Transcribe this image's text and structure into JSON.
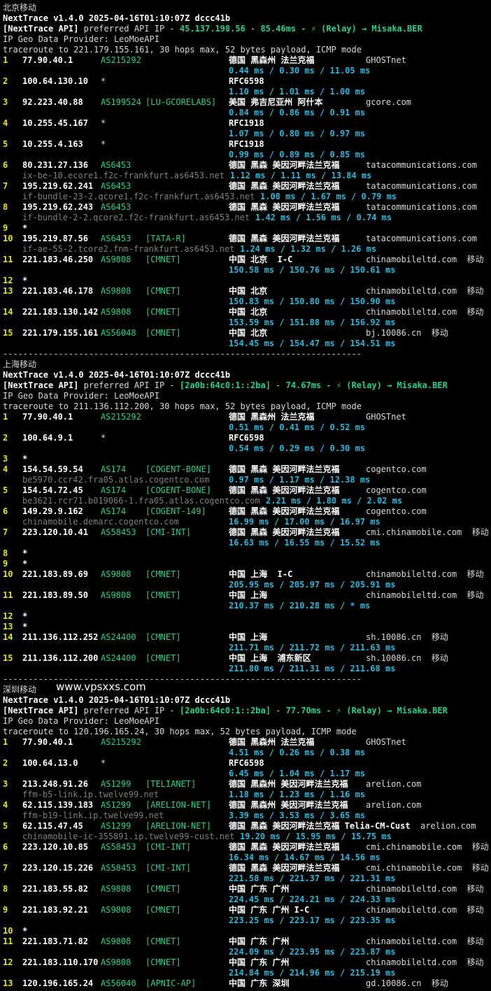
{
  "sections": [
    {
      "label": "北京移动",
      "version": "NextTrace v1.4.0 2025-04-16T01:10:07Z dccc41b",
      "api_tag": "[NextTrace API]",
      "api_mid": " preferred API IP - ",
      "api_ip": "45.137.198.56",
      "api_sep": " - ",
      "api_ms": "85.46ms",
      "api_tail": " - ⚡ (Relay) → Misaka.BER",
      "geo": "IP Geo Data Provider: LeoMoeAPI",
      "trace": "traceroute to 221.179.155.161, 30 hops max, 52 bytes payload, ICMP mode",
      "hops": [
        {
          "n": "1",
          "ip": "77.90.40.1",
          "asn": "AS215292",
          "tag": "",
          "geo": "德国 黑森州 法兰克福",
          "org": "GHOSTnet",
          "ptr": "",
          "rtt": "0.44 ms / 0.30 ms / 11.05 ms"
        },
        {
          "n": "2",
          "ip": "100.64.130.10",
          "asn": "*",
          "tag": "",
          "geo": "RFC6598",
          "org": "",
          "ptr": "",
          "rtt": "1.10 ms / 1.01 ms / 1.00 ms"
        },
        {
          "n": "3",
          "ip": "92.223.40.88",
          "asn": "AS199524",
          "tag": "[LU-GCORELABS]",
          "geo": "美国 弗吉尼亚州 阿什本",
          "org": "gcore.com",
          "ptr": "",
          "rtt": "0.84 ms / 0.86 ms / 0.91 ms"
        },
        {
          "n": "4",
          "ip": "10.255.45.167",
          "asn": "*",
          "tag": "",
          "geo": "RFC1918",
          "org": "",
          "ptr": "",
          "rtt": "1.07 ms / 0.80 ms / 0.97 ms"
        },
        {
          "n": "5",
          "ip": "10.255.4.163",
          "asn": "*",
          "tag": "",
          "geo": "RFC1918",
          "org": "",
          "ptr": "",
          "rtt": "0.99 ms / 0.89 ms / 0.85 ms"
        },
        {
          "n": "6",
          "ip": "80.231.27.136",
          "asn": "AS6453",
          "tag": "",
          "geo": "德国 黑森 美因河畔法兰克福",
          "org": "tatacommunications.com",
          "ptr": "ix-be-10.ecore1.f2c-frankfurt.as6453.net",
          "rtt": "1.12 ms / 1.11 ms / 13.84 ms"
        },
        {
          "n": "7",
          "ip": "195.219.62.241",
          "asn": "AS6453",
          "tag": "",
          "geo": "德国 黑森 美因河畔法兰克福",
          "org": "tatacommunications.com",
          "ptr": "if-bundle-23-2.qcore1.f2c-frankfurt.as6453.net",
          "rtt": "1.08 ms / 1.67 ms / 0.79 ms"
        },
        {
          "n": "8",
          "ip": "195.219.62.243",
          "asn": "AS6453",
          "tag": "",
          "geo": "德国 黑森 美因河畔法兰克福",
          "org": "tatacommunications.com",
          "ptr": "if-bundle-2-2.qcore2.f2c-frankfurt.as6453.net",
          "rtt": "1.42 ms / 1.56 ms / 0.74 ms"
        },
        {
          "n": "9",
          "star": true
        },
        {
          "n": "10",
          "ip": "195.219.87.56",
          "asn": "AS6453",
          "tag": "[TATA-R]",
          "geo": "德国 黑森 美因河畔法兰克福",
          "org": "tatacommunications.com",
          "ptr": "if-ae-55-2.tcore2.fnm-frankfurt.as6453.net",
          "rtt": "1.24 ms / 1.32 ms / 1.26 ms"
        },
        {
          "n": "11",
          "ip": "221.183.46.250",
          "asn": "AS9808",
          "tag": "[CMNET]",
          "geo": "中国 北京  I-C",
          "org": "chinamobileltd.com  移动",
          "ptr": "",
          "rtt": "150.58 ms / 150.76 ms / 150.61 ms"
        },
        {
          "n": "12",
          "star": true
        },
        {
          "n": "13",
          "ip": "221.183.46.178",
          "asn": "AS9808",
          "tag": "[CMNET]",
          "geo": "中国 北京",
          "org": "chinamobileltd.com  移动",
          "ptr": "",
          "rtt": "150.83 ms / 150.80 ms / 150.90 ms"
        },
        {
          "n": "14",
          "ip": "221.183.130.142",
          "asn": "AS9808",
          "tag": "[CMNET]",
          "geo": "中国 北京",
          "org": "chinamobileltd.com  移动",
          "ptr": "",
          "rtt": "153.59 ms / 151.88 ms / 156.92 ms"
        },
        {
          "n": "15",
          "ip": "221.179.155.161",
          "asn": "AS56048",
          "tag": "[CMNET]",
          "geo": "中国 北京",
          "org": "bj.10086.cn  移动",
          "ptr": "",
          "rtt": "154.45 ms / 154.47 ms / 154.51 ms"
        }
      ]
    },
    {
      "label": "上海移动",
      "version": "NextTrace v1.4.0 2025-04-16T01:10:07Z dccc41b",
      "api_tag": "[NextTrace API]",
      "api_mid": " preferred API IP - ",
      "api_ip": "[2a0b:64c0:1::2ba]",
      "api_sep": " - ",
      "api_ms": "74.67ms",
      "api_tail": " - ⚡ (Relay) → Misaka.BER",
      "geo": "IP Geo Data Provider: LeoMoeAPI",
      "trace": "traceroute to 211.136.112.200, 30 hops max, 52 bytes payload, ICMP mode",
      "hops": [
        {
          "n": "1",
          "ip": "77.90.40.1",
          "asn": "AS215292",
          "tag": "",
          "geo": "德国 黑森州 法兰克福",
          "org": "GHOSTnet",
          "ptr": "",
          "rtt": "0.51 ms / 0.41 ms / 0.52 ms"
        },
        {
          "n": "2",
          "ip": "100.64.9.1",
          "asn": "*",
          "tag": "",
          "geo": "RFC6598",
          "org": "",
          "ptr": "",
          "rtt": "0.54 ms / 0.29 ms / 0.30 ms"
        },
        {
          "n": "3",
          "star": true
        },
        {
          "n": "4",
          "ip": "154.54.59.54",
          "asn": "AS174",
          "tag": "[COGENT-BONE]",
          "geo": "德国 黑森 美因河畔法兰克福",
          "org": "cogentco.com",
          "ptr": "be5970.ccr42.fra05.atlas.cogentco.com",
          "rtt": "0.97 ms / 1.17 ms / 12.38 ms"
        },
        {
          "n": "5",
          "ip": "154.54.72.45",
          "asn": "AS174",
          "tag": "[COGENT-BONE]",
          "geo": "德国 黑森 美因河畔法兰克福",
          "org": "cogentco.com",
          "ptr": "be3621.rcr71.b019066-1.fra05.atlas.cogentco.com",
          "rtt": "2.21 ms / 1.80 ms / 2.02 ms"
        },
        {
          "n": "6",
          "ip": "149.29.9.162",
          "asn": "AS174",
          "tag": "[COGENT-149]",
          "geo": "德国 黑森 美因河畔法兰克福",
          "org": "cogentco.com",
          "ptr": "chinamobile.demarc.cogentco.com",
          "rtt": "16.99 ms / 17.00 ms / 16.97 ms"
        },
        {
          "n": "7",
          "ip": "223.120.10.41",
          "asn": "AS58453",
          "tag": "[CMI-INT]",
          "geo": "德国 黑森 美因河畔法兰克福",
          "org": "cmi.chinamobile.com  移动",
          "ptr": "",
          "rtt": "16.63 ms / 16.55 ms / 15.52 ms"
        },
        {
          "n": "8",
          "star": true
        },
        {
          "n": "9",
          "star": true
        },
        {
          "n": "10",
          "ip": "221.183.89.69",
          "asn": "AS9808",
          "tag": "[CMNET]",
          "geo": "中国 上海  I-C",
          "org": "chinamobileltd.com  移动",
          "ptr": "",
          "rtt": "205.95 ms / 205.97 ms / 205.91 ms"
        },
        {
          "n": "11",
          "ip": "221.183.89.50",
          "asn": "AS9808",
          "tag": "[CMNET]",
          "geo": "中国 上海",
          "org": "chinamobileltd.com  移动",
          "ptr": "",
          "rtt": "210.37 ms / 210.28 ms / * ms"
        },
        {
          "n": "12",
          "star": true
        },
        {
          "n": "13",
          "star": true
        },
        {
          "n": "14",
          "ip": "211.136.112.252",
          "asn": "AS24400",
          "tag": "[CMNET]",
          "geo": "中国 上海",
          "org": "sh.10086.cn  移动",
          "ptr": "",
          "rtt": "211.71 ms / 211.72 ms / 211.63 ms"
        },
        {
          "n": "15",
          "ip": "211.136.112.200",
          "asn": "AS24400",
          "tag": "[CMNET]",
          "geo": "中国 上海  浦东新区",
          "org": "sh.10086.cn  移动",
          "ptr": "",
          "rtt": "211.80 ms / 211.31 ms / 211.68 ms"
        }
      ]
    },
    {
      "label": "深圳移动",
      "watermark": "www.vpsxxs.com",
      "version": "NextTrace v1.4.0 2025-04-16T01:10:07Z dccc41b",
      "api_tag": "[NextTrace API]",
      "api_mid": " preferred API IP - ",
      "api_ip": "[2a0b:64c0:1::2ba]",
      "api_sep": " - ",
      "api_ms": "77.70ms",
      "api_tail": " - ⚡ (Relay) → Misaka.BER",
      "geo": "IP Geo Data Provider: LeoMoeAPI",
      "trace": "traceroute to 120.196.165.24, 30 hops max, 52 bytes payload, ICMP mode",
      "hops": [
        {
          "n": "1",
          "ip": "77.90.40.1",
          "asn": "AS215292",
          "tag": "",
          "geo": "德国 黑森州 法兰克福",
          "org": "GHOSTnet",
          "ptr": "",
          "rtt": "4.51 ms / 0.26 ms / 0.38 ms"
        },
        {
          "n": "2",
          "ip": "100.64.13.0",
          "asn": "*",
          "tag": "",
          "geo": "RFC6598",
          "org": "",
          "ptr": "",
          "rtt": "6.45 ms / 1.04 ms / 1.17 ms"
        },
        {
          "n": "3",
          "ip": "213.248.91.26",
          "asn": "AS1299",
          "tag": "[TELIANET]",
          "geo": "德国 黑森州 美因河畔法兰克福",
          "org": "arelion.com",
          "ptr": "ffm-b5-link.ip.twelve99.net",
          "rtt": "1.18 ms / 1.23 ms / 1.16 ms"
        },
        {
          "n": "4",
          "ip": "62.115.139.183",
          "asn": "AS1299",
          "tag": "[ARELION-NET]",
          "geo": "德国 黑森州 美因河畔法兰克福",
          "org": "arelion.com",
          "ptr": "ffm-b19-link.ip.twelve99.net",
          "rtt": "3.39 ms / 3.53 ms / 3.65 ms"
        },
        {
          "n": "5",
          "ip": "62.115.47.45",
          "asn": "AS1299",
          "tag": "[ARELION-NET]",
          "geo": "德国 黑森 美因河畔法兰克福 Telia-CM-Cust",
          "org": "arelion.com",
          "ptr": "chinamobile-ic-355891.ip.twelve99-cust.net",
          "rtt": "19.20 ms / 15.95 ms / 15.75 ms"
        },
        {
          "n": "6",
          "ip": "223.120.10.85",
          "asn": "AS58453",
          "tag": "[CMI-INT]",
          "geo": "德国 黑森 美因河畔法兰克福",
          "org": "cmi.chinamobile.com  移动",
          "ptr": "",
          "rtt": "16.34 ms / 14.67 ms / 14.56 ms"
        },
        {
          "n": "7",
          "ip": "223.120.15.226",
          "asn": "AS58453",
          "tag": "[CMI-INT]",
          "geo": "德国 黑森 美因河畔法兰克福",
          "org": "cmi.chinamobile.com  移动",
          "ptr": "",
          "rtt": "221.58 ms / 221.37 ms / 221.31 ms"
        },
        {
          "n": "8",
          "ip": "221.183.55.82",
          "asn": "AS9808",
          "tag": "[CMNET]",
          "geo": "中国 广东 广州",
          "org": "chinamobileltd.com  移动",
          "ptr": "",
          "rtt": "224.45 ms / 224.21 ms / 224.33 ms"
        },
        {
          "n": "9",
          "ip": "221.183.92.21",
          "asn": "AS9808",
          "tag": "[CMNET]",
          "geo": "中国 广东 广州 I-C",
          "org": "chinamobileltd.com  移动",
          "ptr": "",
          "rtt": "223.25 ms / 223.17 ms / 223.35 ms"
        },
        {
          "n": "10",
          "star": true
        },
        {
          "n": "11",
          "ip": "221.183.71.82",
          "asn": "AS9808",
          "tag": "[CMNET]",
          "geo": "中国 广东 广州",
          "org": "chinamobileltd.com  移动",
          "ptr": "",
          "rtt": "224.09 ms / 223.95 ms / 223.87 ms"
        },
        {
          "n": "12",
          "ip": "221.183.110.170",
          "asn": "AS9808",
          "tag": "[CMNET]",
          "geo": "中国 广东 广州",
          "org": "chinamobileltd.com  移动",
          "ptr": "",
          "rtt": "214.84 ms / 214.96 ms / 215.19 ms"
        },
        {
          "n": "13",
          "ip": "120.196.165.24",
          "asn": "AS56040",
          "tag": "[APNIC-AP]",
          "geo": "中国 广东 深圳",
          "org": "gd.10086.cn  移动",
          "ptr": "",
          "rtt": ""
        }
      ]
    }
  ],
  "separator": "-----------------------------------------------------------------------"
}
